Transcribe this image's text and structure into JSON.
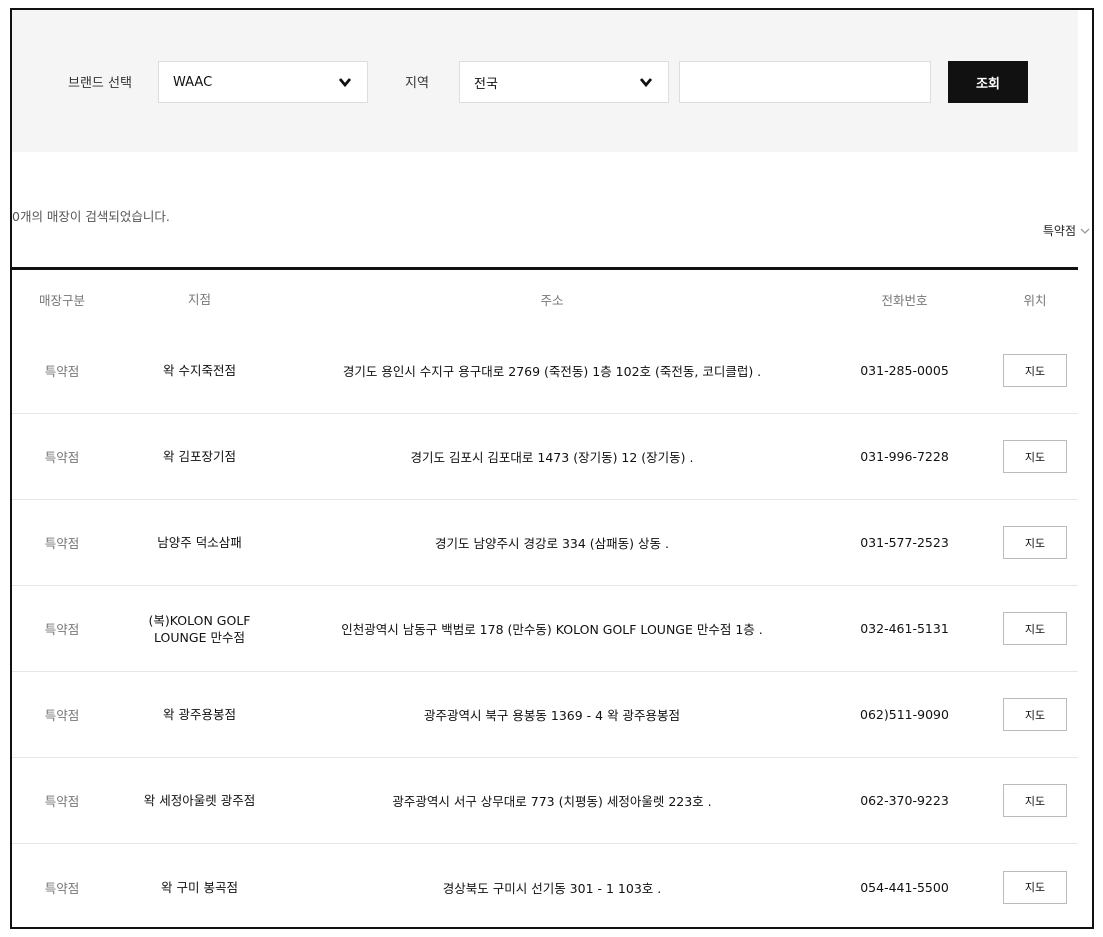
{
  "search": {
    "brand_label": "브랜드 선택",
    "brand_value": "WAAC",
    "region_label": "지역",
    "region_value": "전국",
    "keyword_value": "",
    "search_button": "조회"
  },
  "results": {
    "count_text": "0개의 매장이 검색되었습니다.",
    "sort_label": "특약점"
  },
  "table": {
    "headers": {
      "type": "매장구분",
      "name": "지점",
      "address": "주소",
      "phone": "전화번호",
      "location": "위치"
    },
    "map_button_label": "지도",
    "rows": [
      {
        "type": "특약점",
        "name": "왁 수지죽전점",
        "address": "경기도 용인시 수지구 용구대로 2769 (죽전동) 1층 102호 (죽전동, 코디클럽) .",
        "phone": "031-285-0005"
      },
      {
        "type": "특약점",
        "name": "왁 김포장기점",
        "address": "경기도 김포시 김포대로 1473 (장기동) 12 (장기동) .",
        "phone": "031-996-7228"
      },
      {
        "type": "특약점",
        "name": "남양주 덕소삼패",
        "address": "경기도 남양주시 경강로 334 (삼패동) 상동 .",
        "phone": "031-577-2523"
      },
      {
        "type": "특약점",
        "name": "(복)KOLON GOLF LOUNGE 만수점",
        "address": "인천광역시 남동구 백범로 178 (만수동) KOLON GOLF LOUNGE 만수점 1층 .",
        "phone": "032-461-5131"
      },
      {
        "type": "특약점",
        "name": "왁 광주용봉점",
        "address": "광주광역시 북구 용봉동 1369 - 4 왁 광주용봉점",
        "phone": "062)511-9090"
      },
      {
        "type": "특약점",
        "name": "왁 세정아울렛 광주점",
        "address": "광주광역시 서구 상무대로 773 (치평동) 세정아울렛 223호 .",
        "phone": "062-370-9223"
      },
      {
        "type": "특약점",
        "name": "왁 구미 봉곡점",
        "address": "경상북도 구미시 선기동 301 - 1 103호 .",
        "phone": "054-441-5500"
      }
    ]
  }
}
